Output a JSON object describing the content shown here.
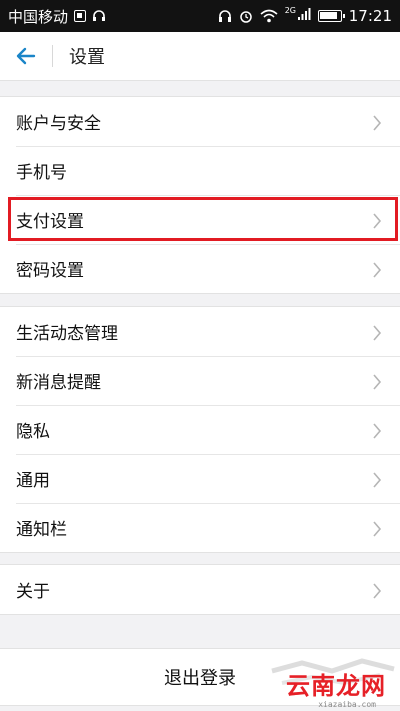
{
  "status_bar": {
    "carrier": "中国移动",
    "network_label": "2G",
    "time": "17:21",
    "icons": [
      "sim-icon",
      "headset-icon",
      "headphones-icon",
      "alarm-icon",
      "wifi-icon",
      "signal-icon",
      "battery-icon"
    ]
  },
  "nav": {
    "title": "设置",
    "back_icon": "back-arrow-icon",
    "accent_color": "#1a85c8"
  },
  "groups": [
    {
      "items": [
        {
          "label": "账户与安全",
          "chevron": true
        },
        {
          "label": "手机号",
          "chevron": false
        },
        {
          "label": "支付设置",
          "chevron": true,
          "highlighted": true
        },
        {
          "label": "密码设置",
          "chevron": true
        }
      ]
    },
    {
      "items": [
        {
          "label": "生活动态管理",
          "chevron": true
        },
        {
          "label": "新消息提醒",
          "chevron": true
        },
        {
          "label": "隐私",
          "chevron": true
        },
        {
          "label": "通用",
          "chevron": true
        },
        {
          "label": "通知栏",
          "chevron": true
        }
      ]
    },
    {
      "items": [
        {
          "label": "关于",
          "chevron": true
        }
      ]
    }
  ],
  "logout_label": "退出登录",
  "highlight_color": "#e21b23",
  "watermark": {
    "text": "云南龙网",
    "sub": "xiazaiba.com"
  }
}
